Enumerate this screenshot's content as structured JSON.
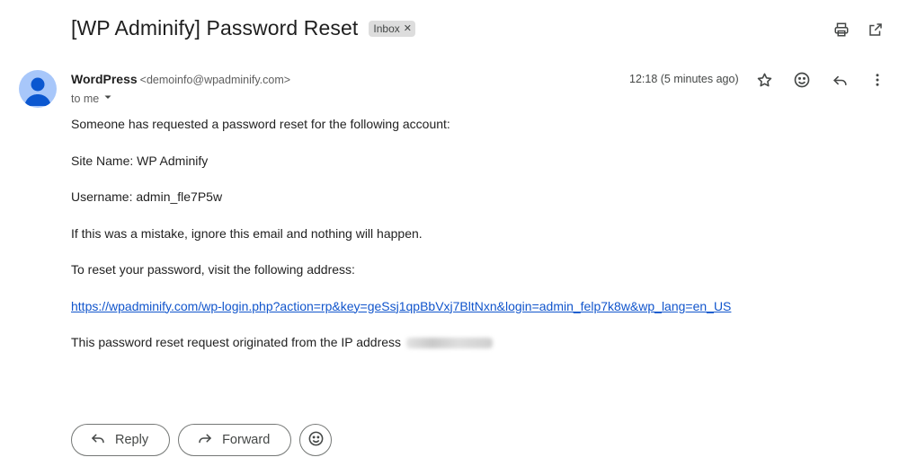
{
  "email": {
    "subject": "[WP Adminify] Password Reset",
    "label": "Inbox",
    "sender_name": "WordPress",
    "sender_email": "<demoinfo@wpadminify.com>",
    "to": "to me",
    "time": "12:18 (5 minutes ago)",
    "body": {
      "line1": "Someone has requested a password reset for the following account:",
      "line2": "Site Name: WP Adminify",
      "line3": "Username: admin_fle7P5w",
      "line4": "If this was a mistake, ignore this email and nothing will happen.",
      "line5": "To reset your password, visit the following address:",
      "link": "https://wpadminify.com/wp-login.php?action=rp&key=geSsj1qpBbVxj7BltNxn&login=admin_felp7k8w&wp_lang=en_US",
      "line6": "This password reset request originated from the IP address"
    }
  },
  "actions": {
    "reply": "Reply",
    "forward": "Forward"
  },
  "icons": {
    "print": "print-icon",
    "open_new_window": "open-in-new-icon",
    "star": "star-icon",
    "emoji": "emoji-icon",
    "reply": "reply-icon",
    "more": "more-vert-icon"
  }
}
